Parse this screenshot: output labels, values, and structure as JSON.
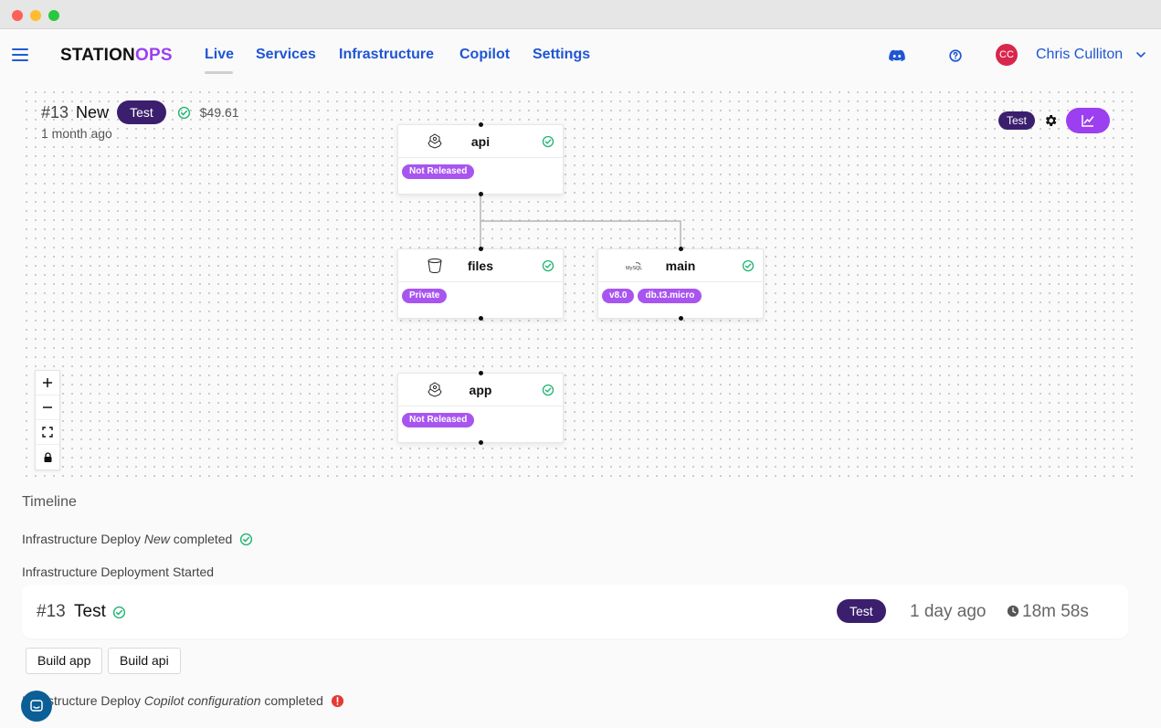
{
  "app": {
    "brand_part1": "STATION",
    "brand_part2": "OPS",
    "nav": [
      {
        "label": "Live"
      },
      {
        "label": "Services"
      },
      {
        "label": "Infrastructure"
      },
      {
        "label": "Copilot"
      },
      {
        "label": "Settings"
      }
    ],
    "header_icons": [
      "discord-icon",
      "help-circle-icon"
    ],
    "user": {
      "initials": "CC",
      "name": "Chris Culliton"
    }
  },
  "deployment": {
    "number": "#13",
    "name": "New",
    "env": "Test",
    "cost": "$49.61",
    "age": "1 month ago",
    "env_small": "Test"
  },
  "nodes": [
    {
      "id": "api",
      "title": "api",
      "icon": "cluster-icon",
      "tags": [
        "Not Released"
      ]
    },
    {
      "id": "files",
      "title": "files",
      "icon": "bucket-icon",
      "tags": [
        "Private"
      ]
    },
    {
      "id": "main",
      "title": "main",
      "icon": "mysql-icon",
      "icon_text": "MySQL",
      "tags": [
        "v8.0",
        "db.t3.micro"
      ]
    },
    {
      "id": "app",
      "title": "app",
      "icon": "cluster-icon",
      "tags": [
        "Not Released"
      ]
    }
  ],
  "timeline": {
    "title": "Timeline",
    "entry1": {
      "prefix": "Infrastructure Deploy ",
      "name": "New",
      "suffix": " completed"
    },
    "entry2": "Infrastructure Deployment Started",
    "card": {
      "number": "#13",
      "name": "Test",
      "env": "Test",
      "when": "1 day ago",
      "duration": "18m 58s"
    },
    "buttons": [
      "Build app",
      "Build api"
    ],
    "entry3": {
      "prefix": "Infrastructure Deploy ",
      "name": "Copilot configuration",
      "suffix": " completed"
    }
  },
  "colors": {
    "nav_blue": "#1f55d4",
    "brand_purple": "#9b3ff0",
    "pill_dark": "#3b1f6e",
    "tag_purple": "#a855f0",
    "success_green": "#22b573",
    "error_red": "#e53935"
  }
}
